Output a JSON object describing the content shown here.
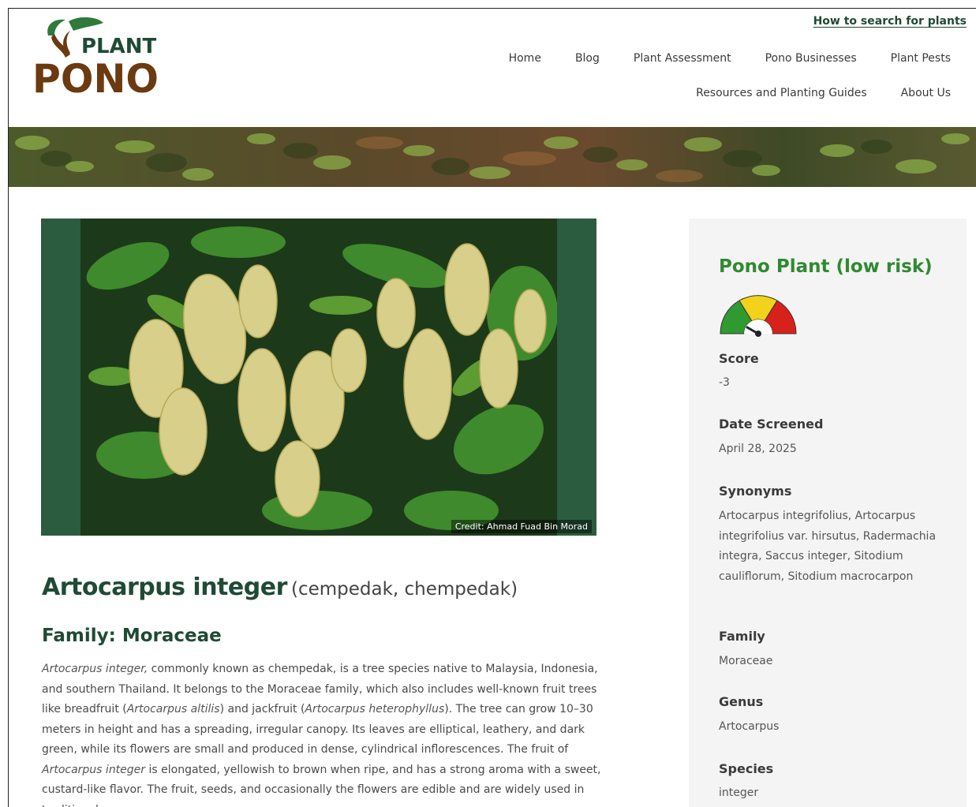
{
  "logo": {
    "line1": "PLANT",
    "line2": "PONO"
  },
  "header": {
    "help_link": "How to search for plants",
    "nav_row1": [
      "Home",
      "Blog",
      "Plant Assessment",
      "Pono Businesses",
      "Plant Pests"
    ],
    "nav_row2": [
      "Resources and Planting Guides",
      "About Us"
    ]
  },
  "photo": {
    "credit": "Credit: Ahmad Fuad Bin Morad"
  },
  "plant": {
    "scientific_name": "Artocarpus integer",
    "common_names": "(cempedak, chempedak)",
    "family_heading": "Family: Moraceae",
    "description": {
      "s1_italic": "Artocarpus integer,",
      "s1_rest": " commonly known as chempedak, is a tree species native to Malaysia, Indonesia, and southern Thailand. It belongs to the Moraceae family, which also includes well-known fruit trees like breadfruit (",
      "s2_italic": "Artocarpus altilis",
      "s2_rest": ") and jackfruit (",
      "s3_italic": "Artocarpus heterophyllus",
      "s3_rest": "). The tree can grow 10–30 meters in height and has a spreading, irregular canopy. Its leaves are elliptical, leathery, and dark green, while its flowers are small and produced in dense, cylindrical inflorescences. The fruit of ",
      "s4_italic": "Artocarpus integer",
      "s4_rest": " is elongated, yellowish to brown when ripe, and has a strong aroma with a sweet, custard-like flavor. The fruit, seeds, and occasionally the flowers are edible and are widely used in traditional"
    }
  },
  "sidebar": {
    "risk_label": "Pono Plant (low risk)",
    "score_label": "Score",
    "score_value": "-3",
    "date_label": "Date Screened",
    "date_value": "April 28, 2025",
    "synonyms_label": "Synonyms",
    "synonyms_value": "Artocarpus integrifolius, Artocarpus integrifolius var. hirsutus, Radermachia integra, Saccus integer, Sitodium cauliflorum, Sitodium macrocarpon",
    "family_label": "Family",
    "family_value": "Moraceae",
    "genus_label": "Genus",
    "genus_value": "Artocarpus",
    "species_label": "Species",
    "species_value": "integer"
  },
  "colors": {
    "brand_green": "#1f4a36",
    "brand_brown": "#6b3a10",
    "risk_green": "#2f8a2f",
    "gauge_green": "#2f9a2f",
    "gauge_yellow": "#f2d21b",
    "gauge_red": "#d9211b",
    "sidebar_bg": "#f4f4f4"
  }
}
